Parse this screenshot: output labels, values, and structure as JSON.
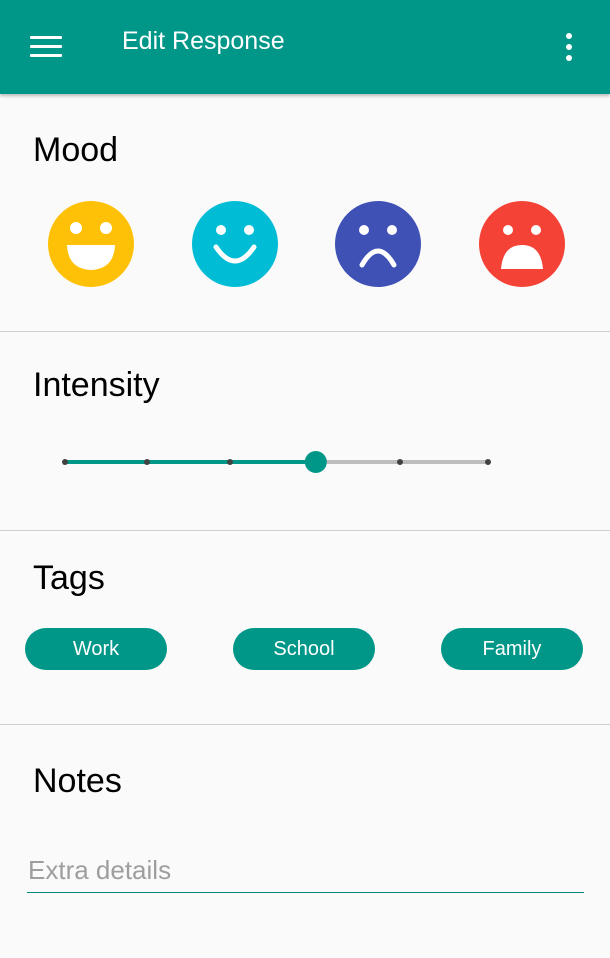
{
  "appbar": {
    "title": "Edit Response",
    "menu_icon": "hamburger-menu-icon",
    "overflow_icon": "more-vert-icon",
    "color": "#009688"
  },
  "mood": {
    "title": "Mood",
    "options": [
      {
        "name": "very-happy",
        "color": "#FFC107"
      },
      {
        "name": "happy",
        "color": "#00BCD4"
      },
      {
        "name": "sad",
        "color": "#3F51B5"
      },
      {
        "name": "very-sad",
        "color": "#F44336"
      }
    ]
  },
  "intensity": {
    "title": "Intensity",
    "steps": 6,
    "selected_step": 3,
    "active_color": "#009688",
    "inactive_color": "#BDBDBD"
  },
  "tags": {
    "title": "Tags",
    "items": [
      "Work",
      "School",
      "Family"
    ]
  },
  "notes": {
    "title": "Notes",
    "placeholder": "Extra details",
    "value": ""
  }
}
